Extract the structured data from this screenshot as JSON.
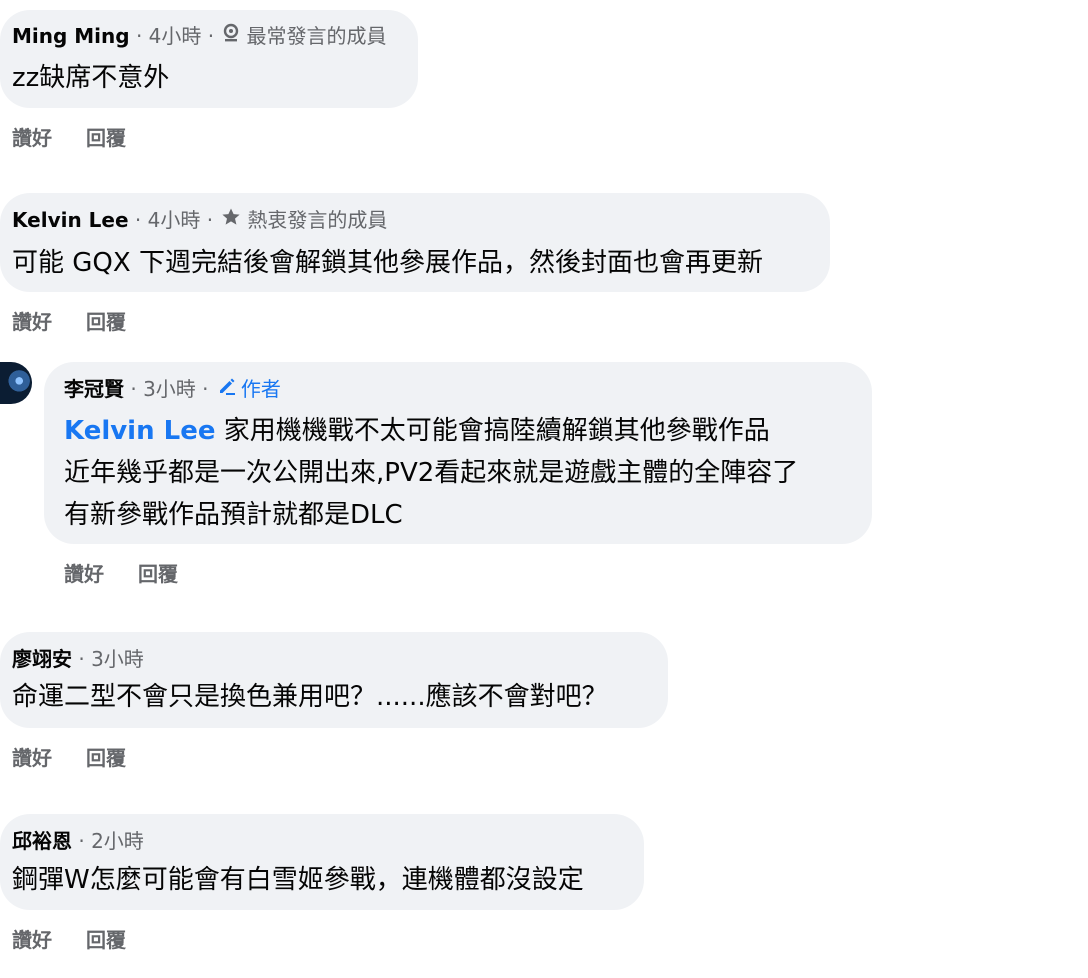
{
  "colors": {
    "bubble_bg": "#f0f2f5",
    "meta_text": "#65676b",
    "link_blue": "#1877f2"
  },
  "actions": {
    "like": "讚好",
    "reply": "回覆"
  },
  "comments": [
    {
      "name": "Ming Ming",
      "time": "4小時",
      "badge_icon": "badge-icon",
      "badge": "最常發言的成員",
      "text": "zz缺席不意外"
    },
    {
      "name": "Kelvin Lee",
      "time": "4小時",
      "badge_icon": "star-icon",
      "badge": "熱衷發言的成員",
      "text": "可能 GQX 下週完結後會解鎖其他參展作品，然後封面也會再更新"
    },
    {
      "name": "李冠賢",
      "time": "3小時",
      "badge_icon": "pencil-icon",
      "badge": "作者",
      "mention": "Kelvin Lee",
      "lines": [
        "家用機機戰不太可能會搞陸續解鎖其他參戰作品",
        "近年幾乎都是一次公開出來,PV2看起來就是遊戲主體的全陣容了",
        "有新參戰作品預計就都是DLC"
      ]
    },
    {
      "name": "廖翊安",
      "time": "3小時",
      "text": "命運二型不會只是換色兼用吧？......應該不會對吧？"
    },
    {
      "name": "邱裕恩",
      "time": "2小時",
      "text": "鋼彈W怎麼可能會有白雪姬參戰，連機體都沒設定"
    }
  ]
}
